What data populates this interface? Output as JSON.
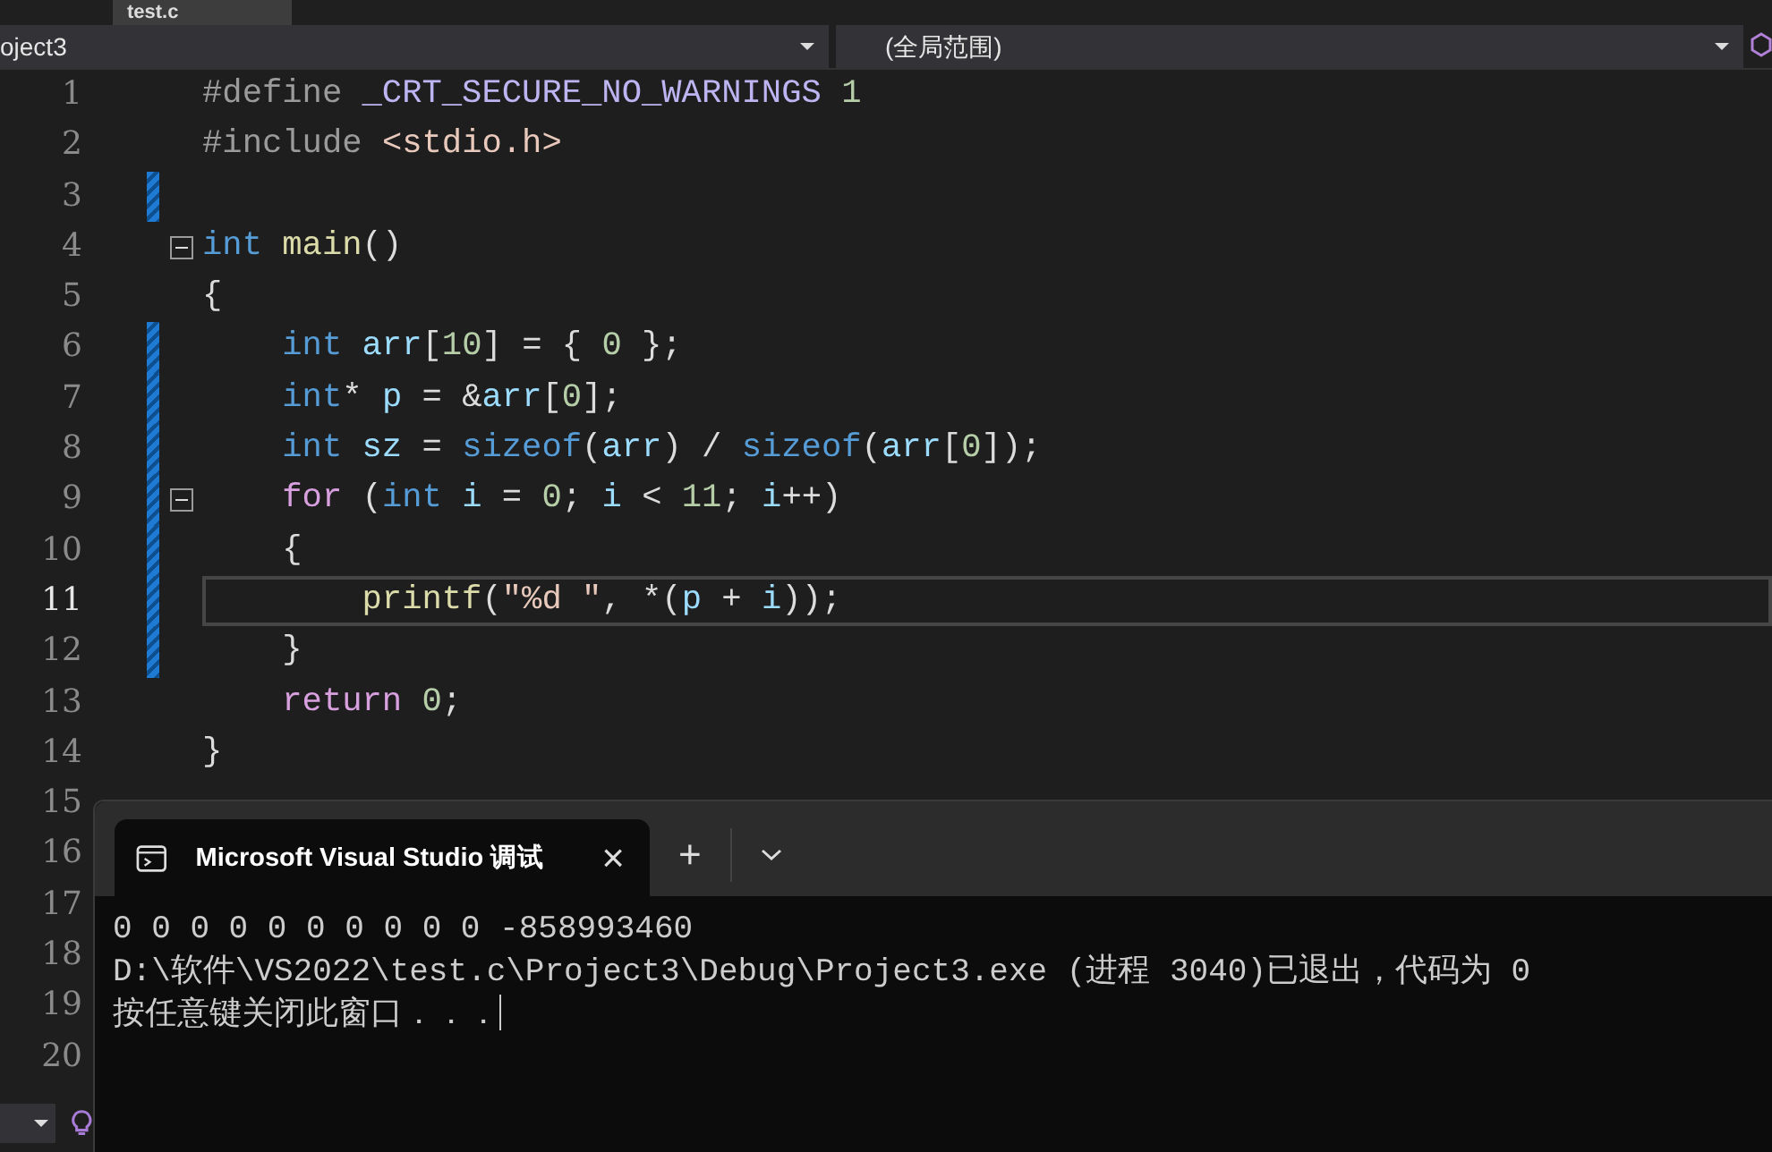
{
  "document_tab": {
    "label": "test.c"
  },
  "navigation_bar": {
    "project": "oject3",
    "scope": "(全局范围)"
  },
  "editor": {
    "lines": [
      {
        "number": "1",
        "changed": false,
        "current": false,
        "collapsible": false,
        "tokens": [
          {
            "text": "#define ",
            "kind": "preproc"
          },
          {
            "text": "_CRT_SECURE_NO_WARNINGS",
            "kind": "macro"
          },
          {
            "text": " 1",
            "kind": "number"
          }
        ]
      },
      {
        "number": "2",
        "changed": false,
        "current": false,
        "collapsible": false,
        "tokens": [
          {
            "text": "#include ",
            "kind": "preproc"
          },
          {
            "text": "<stdio.h>",
            "kind": "string"
          }
        ]
      },
      {
        "number": "3",
        "changed": true,
        "current": false,
        "collapsible": false
      },
      {
        "number": "4",
        "changed": false,
        "current": false,
        "collapsible": true,
        "tokens": [
          {
            "text": "int",
            "kind": "keyword"
          },
          {
            "text": " main",
            "kind": "function"
          },
          {
            "text": "()",
            "kind": "plain"
          }
        ]
      },
      {
        "number": "5",
        "changed": false,
        "current": false,
        "collapsible": false,
        "tokens": [
          {
            "text": "{",
            "kind": "plain"
          }
        ]
      },
      {
        "number": "6",
        "changed": true,
        "current": false,
        "collapsible": false,
        "tokens": [
          {
            "text": "    int",
            "kind": "keyword"
          },
          {
            "text": " arr",
            "kind": "variable"
          },
          {
            "text": "[",
            "kind": "plain"
          },
          {
            "text": "10",
            "kind": "number"
          },
          {
            "text": "] = { ",
            "kind": "plain"
          },
          {
            "text": "0",
            "kind": "number"
          },
          {
            "text": " };",
            "kind": "plain"
          }
        ]
      },
      {
        "number": "7",
        "changed": true,
        "current": false,
        "collapsible": false,
        "tokens": [
          {
            "text": "    int",
            "kind": "keyword"
          },
          {
            "text": "* ",
            "kind": "plain"
          },
          {
            "text": "p",
            "kind": "variable"
          },
          {
            "text": " = &",
            "kind": "plain"
          },
          {
            "text": "arr",
            "kind": "variable"
          },
          {
            "text": "[",
            "kind": "plain"
          },
          {
            "text": "0",
            "kind": "number"
          },
          {
            "text": "];",
            "kind": "plain"
          }
        ]
      },
      {
        "number": "8",
        "changed": true,
        "current": false,
        "collapsible": false,
        "tokens": [
          {
            "text": "    int",
            "kind": "keyword"
          },
          {
            "text": " sz",
            "kind": "variable"
          },
          {
            "text": " = ",
            "kind": "plain"
          },
          {
            "text": "sizeof",
            "kind": "keyword"
          },
          {
            "text": "(",
            "kind": "plain"
          },
          {
            "text": "arr",
            "kind": "variable"
          },
          {
            "text": ") / ",
            "kind": "plain"
          },
          {
            "text": "sizeof",
            "kind": "keyword"
          },
          {
            "text": "(",
            "kind": "plain"
          },
          {
            "text": "arr",
            "kind": "variable"
          },
          {
            "text": "[",
            "kind": "plain"
          },
          {
            "text": "0",
            "kind": "number"
          },
          {
            "text": "]);",
            "kind": "plain"
          }
        ]
      },
      {
        "number": "9",
        "changed": true,
        "current": false,
        "collapsible": true,
        "tokens": [
          {
            "text": "    for",
            "kind": "control"
          },
          {
            "text": " (",
            "kind": "plain"
          },
          {
            "text": "int",
            "kind": "keyword"
          },
          {
            "text": " i",
            "kind": "variable"
          },
          {
            "text": " = ",
            "kind": "plain"
          },
          {
            "text": "0",
            "kind": "number"
          },
          {
            "text": "; ",
            "kind": "plain"
          },
          {
            "text": "i",
            "kind": "variable"
          },
          {
            "text": " < ",
            "kind": "plain"
          },
          {
            "text": "11",
            "kind": "number"
          },
          {
            "text": "; ",
            "kind": "plain"
          },
          {
            "text": "i",
            "kind": "variable"
          },
          {
            "text": "++)",
            "kind": "plain"
          }
        ]
      },
      {
        "number": "10",
        "changed": true,
        "current": false,
        "collapsible": false,
        "tokens": [
          {
            "text": "    {",
            "kind": "plain"
          }
        ]
      },
      {
        "number": "11",
        "changed": true,
        "current": true,
        "collapsible": false,
        "tokens": [
          {
            "text": "        printf",
            "kind": "function"
          },
          {
            "text": "(",
            "kind": "plain"
          },
          {
            "text": "\"%d \"",
            "kind": "string"
          },
          {
            "text": ", *(",
            "kind": "plain"
          },
          {
            "text": "p",
            "kind": "variable"
          },
          {
            "text": " + ",
            "kind": "plain"
          },
          {
            "text": "i",
            "kind": "variable"
          },
          {
            "text": "));",
            "kind": "plain"
          }
        ]
      },
      {
        "number": "12",
        "changed": true,
        "current": false,
        "collapsible": false,
        "tokens": [
          {
            "text": "    }",
            "kind": "plain"
          }
        ]
      },
      {
        "number": "13",
        "changed": false,
        "current": false,
        "collapsible": false,
        "tokens": [
          {
            "text": "    return",
            "kind": "control"
          },
          {
            "text": " 0",
            "kind": "number"
          },
          {
            "text": ";",
            "kind": "plain"
          }
        ]
      },
      {
        "number": "14",
        "changed": false,
        "current": false,
        "collapsible": false,
        "tokens": [
          {
            "text": "}",
            "kind": "plain"
          }
        ]
      },
      {
        "number": "15",
        "changed": false,
        "current": false,
        "collapsible": false
      },
      {
        "number": "16",
        "changed": false,
        "current": false,
        "collapsible": false
      },
      {
        "number": "17",
        "changed": false,
        "current": false,
        "collapsible": false
      },
      {
        "number": "18",
        "changed": false,
        "current": false,
        "collapsible": false
      },
      {
        "number": "19",
        "changed": false,
        "current": false,
        "collapsible": false
      },
      {
        "number": "20",
        "changed": false,
        "current": false,
        "collapsible": false
      }
    ]
  },
  "console_window": {
    "tab_title": "Microsoft Visual Studio 调试",
    "close": "×",
    "new_tab": "+",
    "output": [
      "0 0 0 0 0 0 0 0 0 0 -858993460",
      "D:\\软件\\VS2022\\test.c\\Project3\\Debug\\Project3.exe (进程 3040)已退出，代码为 0",
      "按任意键关闭此窗口．．．"
    ]
  }
}
